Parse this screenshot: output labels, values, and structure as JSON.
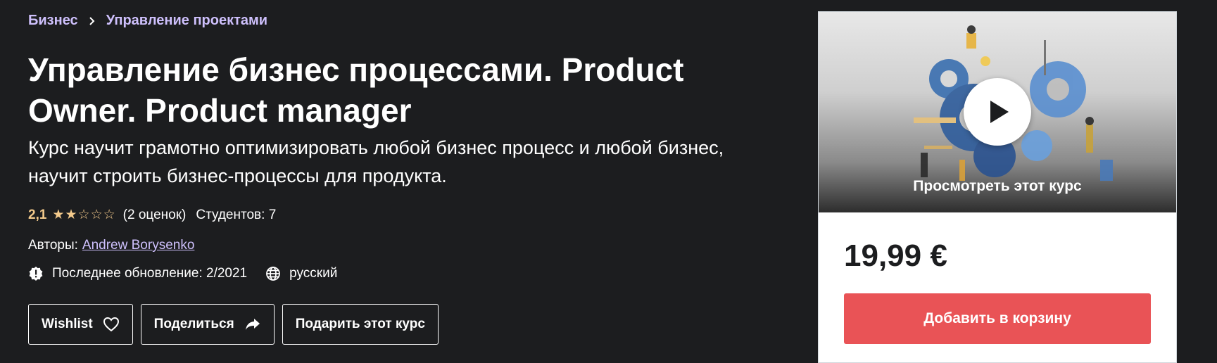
{
  "breadcrumb": {
    "items": [
      "Бизнес",
      "Управление проектами"
    ],
    "separator_icon": "chevron-right-icon"
  },
  "course": {
    "title": "Управление бизнес процессами. Product Owner. Product manager",
    "subtitle": "Курс научит грамотно оптимизировать любой бизнес процесс и любой бизнес, научит строить бизнес-процессы для продукта.",
    "rating_value": "2,1",
    "rating_stars": 2,
    "rating_max": 5,
    "rating_count": "(2 оценок)",
    "students": "Студентов: 7",
    "authors_label": "Авторы:",
    "author_name": "Andrew Borysenko",
    "last_update": "Последнее обновление: 2/2021",
    "language": "русский"
  },
  "buttons": {
    "wishlist": "Wishlist",
    "share": "Поделиться",
    "gift": "Подарить этот курс"
  },
  "card": {
    "preview_label": "Просмотреть этот курс",
    "price": "19,99 €",
    "add_to_cart": "Добавить в корзину"
  },
  "colors": {
    "background": "#1c1d1f",
    "link": "#cec0fc",
    "rating": "#f3ca8c",
    "cart_button": "#e95356",
    "price_text": "#1c1d1f"
  },
  "icons": {
    "alert": "alert-badge-icon",
    "language": "globe-icon",
    "wishlist": "heart-icon",
    "share": "share-arrow-icon",
    "play": "play-icon"
  }
}
